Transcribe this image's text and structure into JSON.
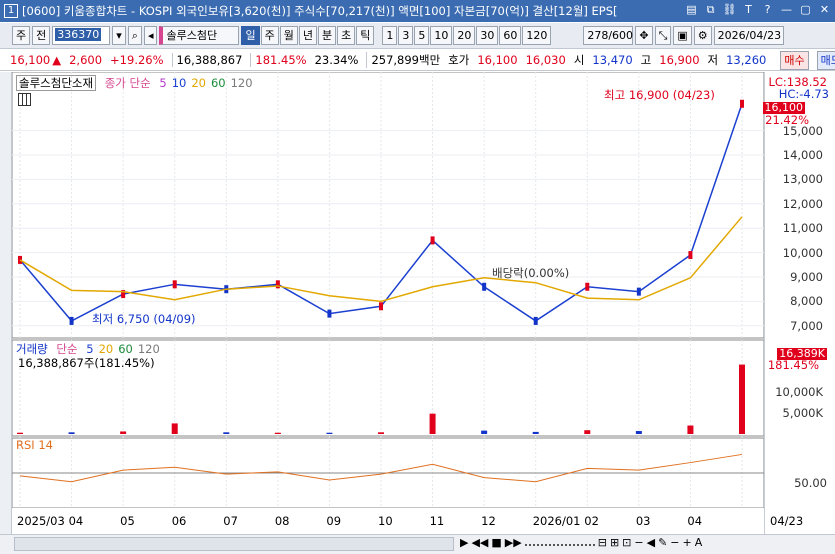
{
  "title": {
    "screen_no": "1",
    "text": "[0600] 키움종합차트 - KOSPI 외국인보유[3,620(천)] 주식수[70,217(천)] 액면[100] 자본금[70(억)] 결산[12월] EPS[",
    "icons": [
      "list-icon",
      "window-icon",
      "link-icon",
      "text-icon",
      "help-icon",
      "minimize-icon",
      "maximize-icon",
      "close-icon"
    ],
    "icon_glyphs": [
      "▤",
      "⧉",
      "⛓",
      "T",
      "?",
      "—",
      "▢",
      "✕"
    ]
  },
  "toolbar": {
    "market": "주",
    "stock_type": "전",
    "code": "336370",
    "stock_name": "솔루스첨단",
    "period_buttons": [
      "일",
      "주",
      "월",
      "년",
      "분",
      "초",
      "틱"
    ],
    "period_selected": "일",
    "interval_buttons": [
      "1",
      "3",
      "5",
      "10",
      "20",
      "30",
      "60",
      "120"
    ],
    "count": "278/600",
    "date": "2026/04/23",
    "buy_label": "매수",
    "sell_label": "매도"
  },
  "quote": {
    "price": "16,100",
    "change": "2,600",
    "change_pct": "+19.26%",
    "volume": "16,388,867",
    "vol_ratio": "181.45%",
    "turnover": "23.34%",
    "amount": "257,899백만",
    "hoga_label": "호가",
    "ask": "16,100",
    "bid": "16,030",
    "open_label": "시",
    "open": "13,470",
    "high_label": "고",
    "high": "16,900",
    "low_label": "저",
    "low": "13,260"
  },
  "price_legend": {
    "name": "솔루스첨단소재",
    "ma_label": "종가 단순",
    "ma_periods": [
      "5",
      "10",
      "20",
      "60",
      "120"
    ],
    "ma_colors": [
      "#b43cc8",
      "#1c40d0",
      "#e2a800",
      "#1e8c3c",
      "#7a7a7a"
    ]
  },
  "price_axis": {
    "lc": "LC:138.52",
    "hc": "HC:-4.73",
    "current_tag": "16,100",
    "current_pct": "21.42%",
    "ticks": [
      "15,000",
      "14,000",
      "13,000",
      "12,000",
      "11,000",
      "10,000",
      "9,000",
      "8,000",
      "7,000"
    ]
  },
  "annotations": {
    "high": "최고 16,900 (04/23)",
    "low": "최저 6,750 (04/09)",
    "dividend": "배당락(0.00%)"
  },
  "volume_legend": {
    "name": "거래량",
    "ma_label": "단순",
    "ma_periods": [
      "5",
      "20",
      "60",
      "120"
    ],
    "summary": "16,388,867주(181.45%)"
  },
  "volume_axis": {
    "current_tag": "16,389K",
    "current_pct": "181.45%",
    "ticks": [
      "10,000K",
      "5,000K"
    ]
  },
  "rsi": {
    "label": "RSI 14",
    "tick": "50.00"
  },
  "timeline": {
    "labels": [
      "2025/03",
      "04",
      "05",
      "06",
      "07",
      "08",
      "09",
      "10",
      "11",
      "12",
      "2026/01",
      "02",
      "03",
      "04"
    ],
    "right_label": "04/23"
  },
  "chart_data": {
    "type": "line",
    "title": "솔루스첨단소재",
    "x": [
      "2025/03",
      "2025/04",
      "2025/05",
      "2025/06",
      "2025/07",
      "2025/08",
      "2025/09",
      "2025/10",
      "2025/11",
      "2025/12",
      "2026/01",
      "2026/02",
      "2026/03",
      "2026/04",
      "2026/04/23"
    ],
    "series": [
      {
        "name": "종가",
        "values": [
          9700,
          7200,
          8300,
          8700,
          8500,
          8700,
          7500,
          7800,
          10500,
          8600,
          7200,
          8600,
          8400,
          9900,
          16100
        ]
      }
    ],
    "ylim": [
      6500,
      16500
    ],
    "volume": [
      300,
      400,
      600,
      2500,
      400,
      300,
      300,
      400,
      4800,
      800,
      500,
      900,
      700,
      2000,
      16389
    ],
    "volume_unit": "K",
    "rsi": [
      45,
      35,
      55,
      60,
      48,
      52,
      38,
      48,
      65,
      42,
      35,
      58,
      55,
      68,
      82
    ]
  }
}
